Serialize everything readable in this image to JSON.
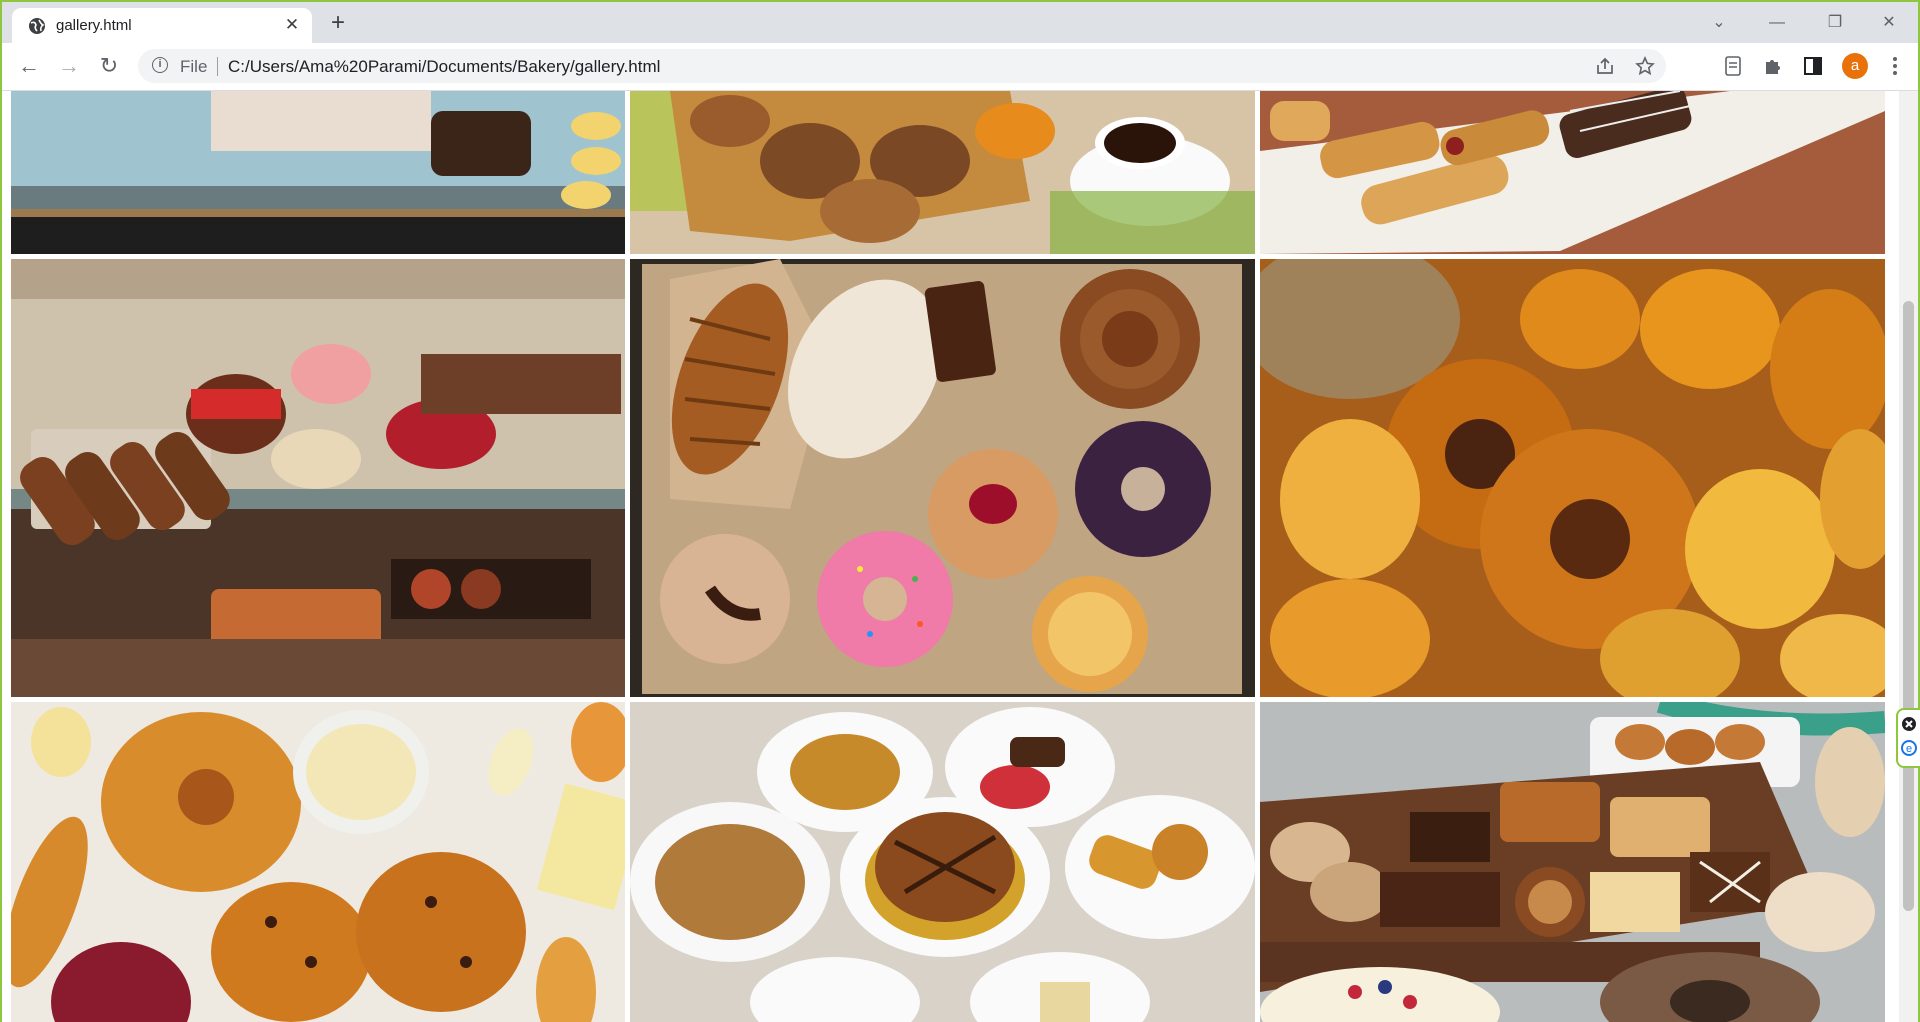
{
  "tab": {
    "title": "gallery.html",
    "close": "✕"
  },
  "newtab": "+",
  "window": {
    "dropdown": "⌄",
    "minimize": "—",
    "restore": "❐",
    "close": "✕"
  },
  "nav": {
    "back": "←",
    "forward": "→",
    "reload": "↻"
  },
  "omnibox": {
    "info": "i",
    "file_label": "File",
    "url": "C:/Users/Ama%20Parami/Documents/Bakery/gallery.html"
  },
  "toolbar": {
    "avatar_letter": "a"
  },
  "gallery": {
    "tiles": [
      "bakery display case with cakes",
      "bread rolls with coffee",
      "pastries on a plate",
      "pastry display case",
      "box of croissants and doughnuts",
      "bagels and pastries",
      "croissants with butter and jam",
      "plates of baked goods",
      "tray of cookies and cakes"
    ]
  }
}
